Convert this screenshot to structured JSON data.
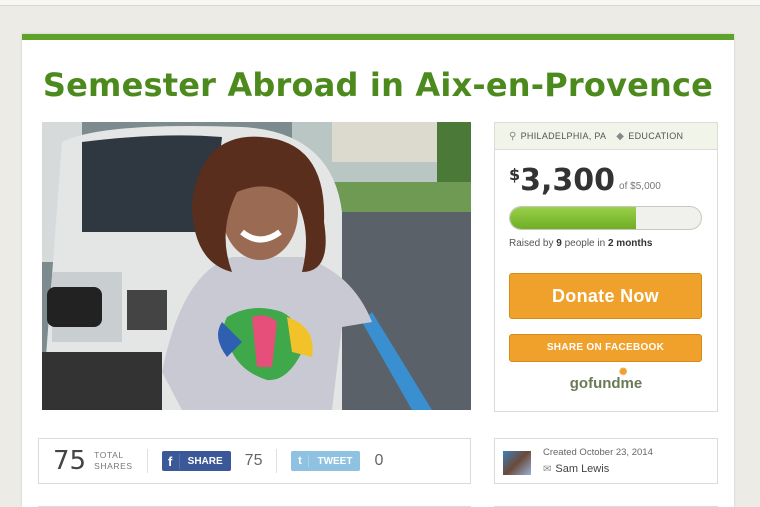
{
  "campaign": {
    "title": "Semester Abroad in Aix-en-Provence",
    "location": "PHILADELPHIA, PA",
    "category": "EDUCATION",
    "currency_symbol": "$",
    "raised_amount": "3,300",
    "goal_text": "of $5,000",
    "progress_fraction": 0.66,
    "raised_prefix": "Raised by ",
    "raised_people": "9",
    "raised_mid": " people in ",
    "raised_time": "2 months"
  },
  "buttons": {
    "donate": "Donate Now",
    "share_facebook": "SHARE ON FACEBOOK"
  },
  "logo": {
    "text": "gofundme"
  },
  "share_bar": {
    "total_shares": "75",
    "total_label_1": "TOTAL",
    "total_label_2": "SHARES",
    "fb_label": "SHARE",
    "fb_count": "75",
    "tw_label": "TWEET",
    "tw_count": "0"
  },
  "creator": {
    "created": "Created October 23, 2014",
    "name": "Sam Lewis"
  },
  "icons": {
    "location": "map-pin-icon",
    "category": "tag-icon",
    "mail": "envelope-icon"
  },
  "colors": {
    "accent_green": "#5ea22a",
    "title_green": "#4d8a1e",
    "donate_orange": "#f0a12b",
    "facebook_blue": "#3b5998",
    "twitter_blue": "#8fc1e0"
  }
}
